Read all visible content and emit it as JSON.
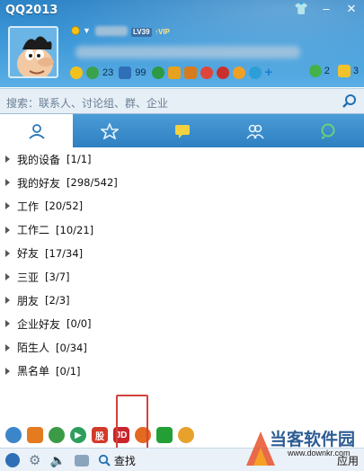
{
  "window": {
    "title": "QQ2013"
  },
  "profile": {
    "level": "LV39",
    "vip": "VIP",
    "status_icon": "online-status"
  },
  "status_row": [
    {
      "icon": "star-icon",
      "num": ""
    },
    {
      "icon": "qzone-icon",
      "num": "23"
    },
    {
      "icon": "mail-icon",
      "num": "99"
    },
    {
      "icon": "clover-icon",
      "num": ""
    },
    {
      "icon": "cart-icon",
      "num": ""
    },
    {
      "icon": "wallet-icon",
      "num": ""
    },
    {
      "icon": "game-icon",
      "num": ""
    },
    {
      "icon": "penguin-icon",
      "num": ""
    },
    {
      "icon": "music-icon",
      "num": ""
    },
    {
      "icon": "compass-icon",
      "num": ""
    },
    {
      "icon": "plus-icon",
      "num": ""
    }
  ],
  "right_status": [
    {
      "icon": "chat-bubble-icon",
      "num": "2"
    },
    {
      "icon": "message-box-icon",
      "num": "3"
    }
  ],
  "search": {
    "placeholder": "搜索：联系人、讨论组、群、企业"
  },
  "tabs": [
    "contacts",
    "favorites",
    "chats",
    "groups",
    "recent"
  ],
  "groups": [
    {
      "name": "我的设备",
      "count": "[1/1]"
    },
    {
      "name": "我的好友",
      "count": "[298/542]"
    },
    {
      "name": "工作",
      "count": "[20/52]"
    },
    {
      "name": "工作二",
      "count": "[10/21]"
    },
    {
      "name": "好友",
      "count": "[17/34]"
    },
    {
      "name": "三亚",
      "count": "[3/7]"
    },
    {
      "name": "朋友",
      "count": "[2/3]"
    },
    {
      "name": "企业好友",
      "count": "[0/0]"
    },
    {
      "name": "陌生人",
      "count": "[0/34]"
    },
    {
      "name": "黑名单",
      "count": "[0/1]"
    }
  ],
  "apps": [
    {
      "label": "",
      "color": "#3b86c9",
      "icon": "qq-browser-icon"
    },
    {
      "label": "",
      "color": "#e57b20",
      "icon": "qq-pet-icon"
    },
    {
      "label": "",
      "color": "#3b9a45",
      "icon": "earth-icon"
    },
    {
      "label": "",
      "color": "#2f9e5c",
      "icon": "play-icon"
    },
    {
      "label": "股",
      "color": "#d23a2a",
      "icon": "stock-icon"
    },
    {
      "label": "JD",
      "color": "#c9252b",
      "icon": "jd-icon"
    },
    {
      "label": "",
      "color": "#e46a1f",
      "icon": "orange-icon"
    },
    {
      "label": "",
      "color": "#23a035",
      "icon": "shield-icon"
    },
    {
      "label": "",
      "color": "#e7a22c",
      "icon": "pet-face-icon"
    }
  ],
  "bottom": {
    "find_label": "查找",
    "apply_label": "应用"
  },
  "watermark": {
    "title": "当客软件园",
    "url": "www.downkr.com"
  }
}
